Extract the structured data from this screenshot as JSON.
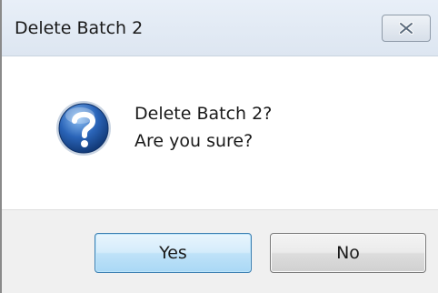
{
  "window": {
    "title": "Delete Batch 2",
    "close_icon": "close-icon"
  },
  "message": {
    "icon": "question-icon",
    "line1": "Delete Batch 2?",
    "line2": "Are you sure?"
  },
  "buttons": {
    "yes_label": "Yes",
    "no_label": "No"
  },
  "colors": {
    "titlebar": "#dde6f1",
    "footer": "#f0f0f0",
    "default_button_border": "#3c7fb1",
    "question_icon_blue": "#2a64b8"
  }
}
